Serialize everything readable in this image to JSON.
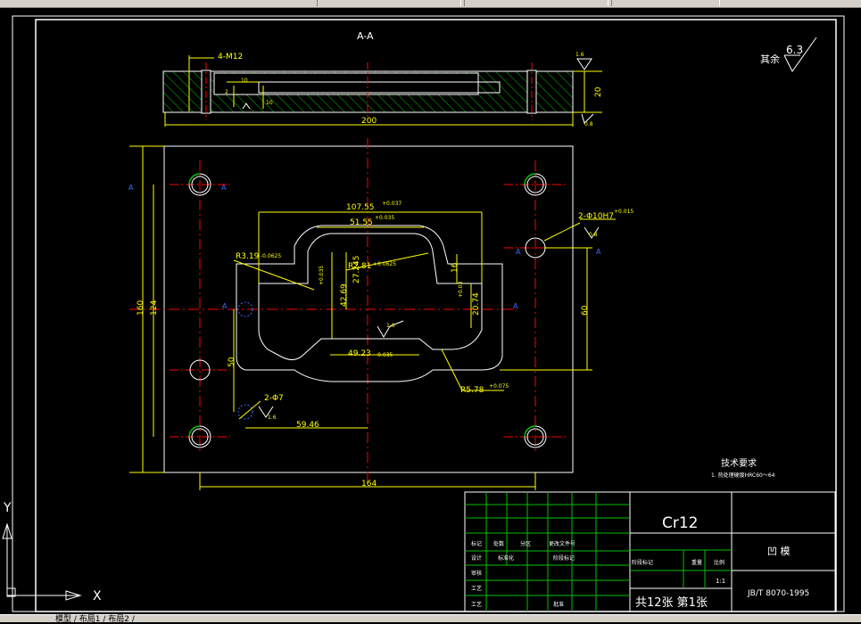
{
  "section_title": "A-A",
  "surface_finish": {
    "prefix": "其余",
    "value": "6.3"
  },
  "sec_labels": {
    "m12": "4-M12",
    "d10a": "10",
    "d10b": "10",
    "d2": "2",
    "d20": "20",
    "d200": "200",
    "r16": "1.6",
    "r08": "0.8"
  },
  "plan_labels": {
    "a": "A",
    "d10755": "107.55",
    "d10755_tol": "+0.037",
    "d5155": "51.55",
    "d5155_tol": "+0.035",
    "r319": "R3.19",
    "r319_tol": "-0.0625",
    "r281": "R2.81",
    "r281_tol": "+0.0625",
    "d27245": "27.245",
    "d4269": "42.69",
    "d4269_tol": "+0.035",
    "d16": "16",
    "d2074": "20.74",
    "d2074_tol": "+0.03",
    "hole10": "2-Φ10H7",
    "hole10_tol": "+0.015",
    "r08b": "0.8",
    "d160": "160",
    "d124": "124",
    "d60": "60",
    "d50": "50",
    "r16b": "1.6",
    "r16c": "1.6",
    "d4923": "49.23",
    "d4923_tol": "-0.035",
    "r578": "R5.78",
    "r578_tol": "+0.075",
    "hole7": "2-Φ7",
    "d5946": "59.46",
    "d164": "164"
  },
  "tech_req": {
    "title": "技术要求",
    "line1": "1. 热处理硬度HRC60～64"
  },
  "title_block": {
    "material": "Cr12",
    "part_name": "凹 模",
    "standard": "JB/T 8070-1995",
    "sheets": "共12张 第1张",
    "scale": "1:1",
    "labels": {
      "mark": "标记",
      "count": "处数",
      "zone": "分区",
      "docno": "更改文件号",
      "design": "设计",
      "stdz": "标准化",
      "stage": "阶段标记",
      "weight": "重量",
      "ratio": "比例",
      "review": "审核",
      "process": "工艺",
      "approve": "批准"
    }
  },
  "ucs": {
    "x": "X",
    "y": "Y"
  },
  "status_text": "模型 / 布局1 / 布局2 /"
}
